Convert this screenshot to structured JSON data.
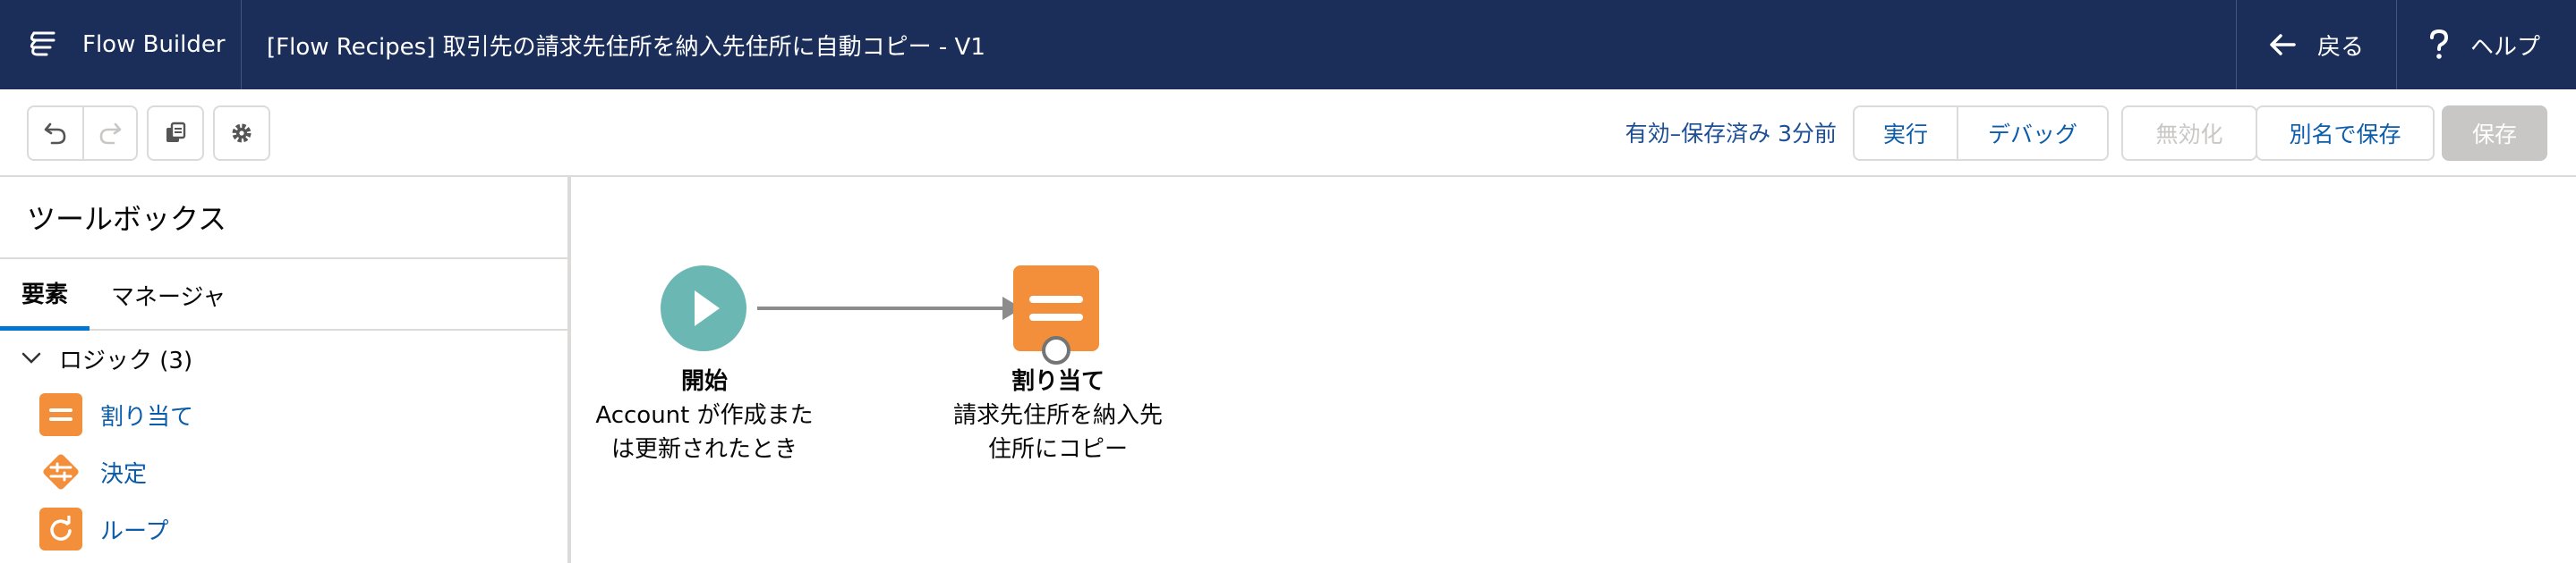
{
  "header": {
    "app_name": "Flow Builder",
    "flow_title": "[Flow Recipes] 取引先の請求先住所を納入先住所に自動コピー - V1",
    "back_label": "戻る",
    "help_label": "ヘルプ"
  },
  "toolbar": {
    "status": "有効–保存済み 3分前",
    "run_label": "実行",
    "debug_label": "デバッグ",
    "deactivate_label": "無効化",
    "save_as_label": "別名で保存",
    "save_label": "保存"
  },
  "sidebar": {
    "title": "ツールボックス",
    "tabs": [
      "要素",
      "マネージャ"
    ],
    "section": "ロジック (3)",
    "items": [
      "割り当て",
      "決定",
      "ループ"
    ]
  },
  "canvas": {
    "start": {
      "name": "開始",
      "desc_line1": "Account が作成また",
      "desc_line2": "は更新されたとき"
    },
    "assignment": {
      "name": "割り当て",
      "desc_line1": "請求先住所を納入先",
      "desc_line2": "住所にコピー"
    }
  },
  "colors": {
    "header_bg": "#1b2e59",
    "start_node": "#6bb7b3",
    "element_orange": "#f38f3a",
    "link_blue": "#0b5cab"
  }
}
